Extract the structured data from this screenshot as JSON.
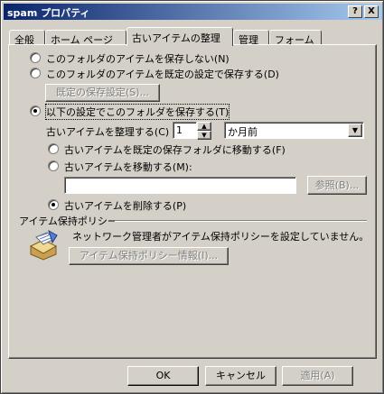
{
  "window": {
    "title": "spam プロパティ",
    "help_button": "?",
    "close_button": "X"
  },
  "tabs": [
    {
      "label": "全般"
    },
    {
      "label": "ホーム ページ"
    },
    {
      "label": "古いアイテムの整理"
    },
    {
      "label": "管理"
    },
    {
      "label": "フォーム"
    }
  ],
  "options": {
    "no_archive": "このフォルダのアイテムを保存しない(N)",
    "default_archive": "このフォルダのアイテムを既定の設定で保存する(D)",
    "default_settings_button": "既定の保存設定(S)...",
    "custom_archive": "以下の設定でこのフォルダを保存する(T)",
    "clean_label": "古いアイテムを整理する(C)",
    "clean_value": "1",
    "clean_unit": "か月前",
    "move_default": "古いアイテムを既定の保存フォルダに移動する(F)",
    "move_to": "古いアイテムを移動する(M):",
    "move_path": "",
    "browse_button": "参照(B)...",
    "delete": "古いアイテムを削除する(P)"
  },
  "policy": {
    "heading": "アイテム保持ポリシー",
    "message": "ネットワーク管理者がアイテム保持ポリシーを設定していません。",
    "info_button": "アイテム保持ポリシー情報(I)..."
  },
  "footer": {
    "ok": "OK",
    "cancel": "キャンセル",
    "apply": "適用(A)"
  }
}
